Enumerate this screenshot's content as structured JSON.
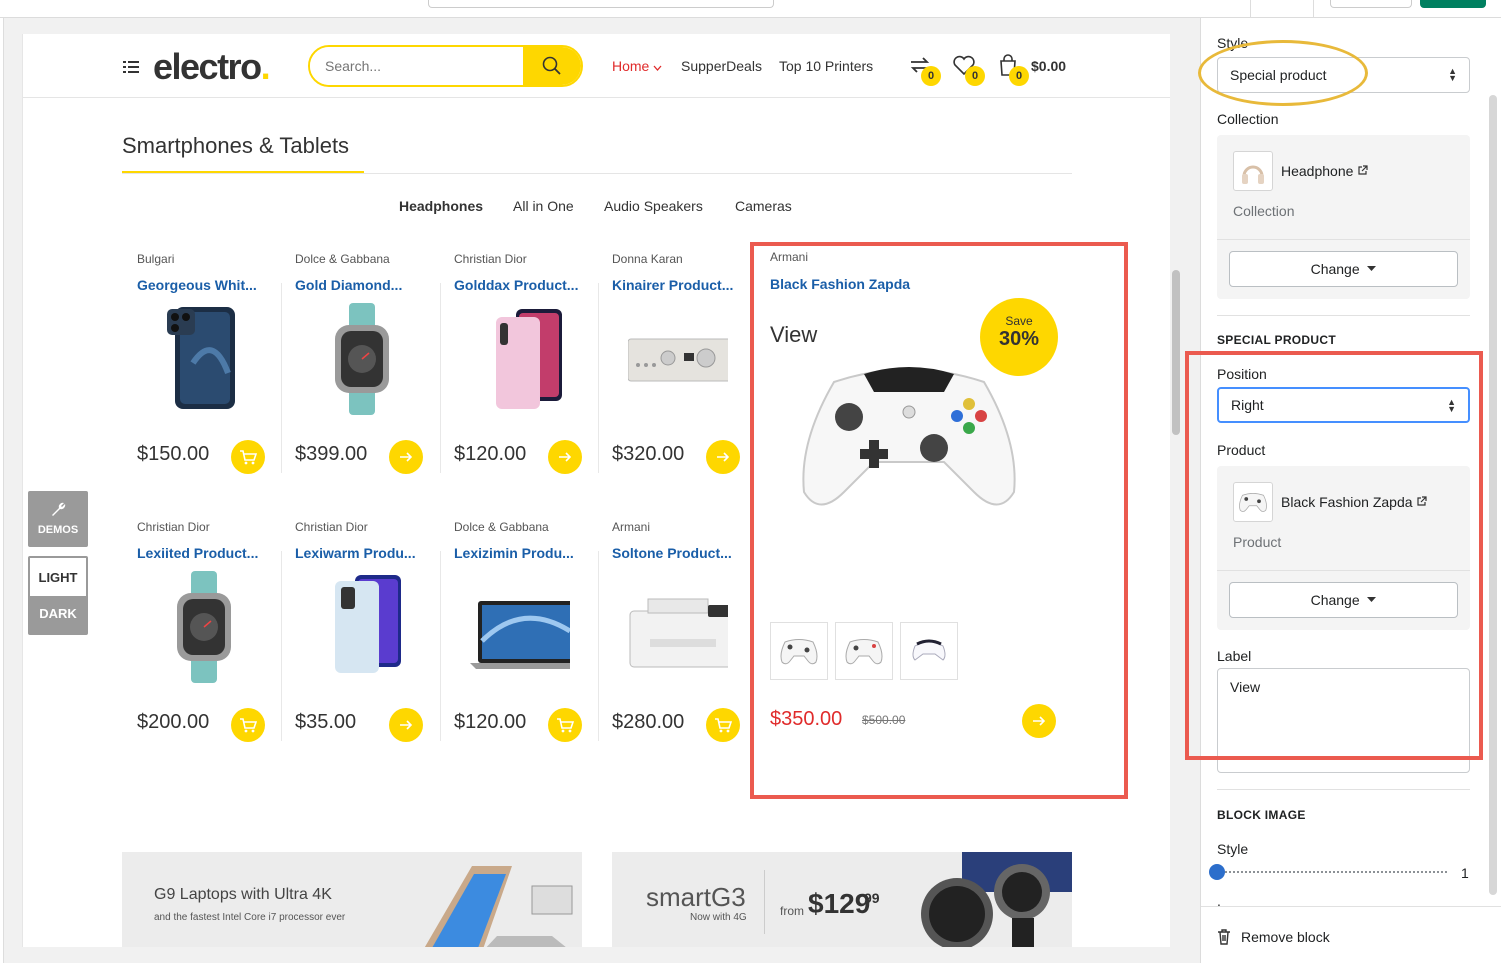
{
  "header": {
    "logo_text": "electro",
    "logo_dot": ".",
    "search_placeholder": "Search...",
    "nav": [
      "Home",
      "SupperDeals",
      "Top 10 Printers"
    ],
    "compare_count": "0",
    "wishlist_count": "0",
    "cart_count": "0",
    "cart_total": "$0.00"
  },
  "section": {
    "title": "Smartphones & Tablets",
    "tabs": [
      "Headphones",
      "All in One",
      "Audio Speakers",
      "Cameras"
    ]
  },
  "products": [
    {
      "brand": "Bulgari",
      "name": "Georgeous Whit...",
      "price": "$150.00",
      "button": "cart-icon"
    },
    {
      "brand": "Dolce & Gabbana",
      "name": "Gold Diamond...",
      "price": "$399.00",
      "button": "arrow-icon"
    },
    {
      "brand": "Christian Dior",
      "name": "Golddax Product...",
      "price": "$120.00",
      "button": "arrow-icon"
    },
    {
      "brand": "Donna Karan",
      "name": "Kinairer Product...",
      "price": "$320.00",
      "button": "arrow-icon"
    },
    {
      "brand": "Christian Dior",
      "name": "Lexiited Product...",
      "price": "$200.00",
      "button": "cart-icon"
    },
    {
      "brand": "Christian Dior",
      "name": "Lexiwarm Produ...",
      "price": "$35.00",
      "button": "arrow-icon"
    },
    {
      "brand": "Dolce & Gabbana",
      "name": "Lexizimin Produ...",
      "price": "$120.00",
      "button": "cart-icon"
    },
    {
      "brand": "Armani",
      "name": "Soltone Product...",
      "price": "$280.00",
      "button": "cart-icon"
    }
  ],
  "special": {
    "brand": "Armani",
    "name": "Black Fashion Zapda",
    "label": "View",
    "save_text": "Save",
    "save_percent": "30%",
    "price": "$350.00",
    "old_price": "$500.00"
  },
  "banners": [
    {
      "title": "G9 Laptops with Ultra 4K",
      "subtitle": "and the fastest Intel Core i7 processor ever"
    },
    {
      "title": "smartG3",
      "subtitle": "Now with 4G",
      "from": "from",
      "price": "$129",
      "cents": "99"
    }
  ],
  "side_tools": {
    "demos": "DEMOS",
    "light": "LIGHT",
    "dark": "DARK"
  },
  "panel": {
    "style_label": "Style",
    "style_value": "Special product",
    "collection_label": "Collection",
    "collection_name": "Headphone",
    "collection_type": "Collection",
    "change_label": "Change",
    "special_heading": "SPECIAL PRODUCT",
    "position_label": "Position",
    "position_value": "Right",
    "product_label": "Product",
    "product_name": "Black Fashion Zapda",
    "product_type": "Product",
    "label_label": "Label",
    "label_value": "View",
    "block_image_heading": "BLOCK IMAGE",
    "block_style_label": "Style",
    "block_style_value": "1",
    "image_label": "Image",
    "remove_label": "Remove block"
  },
  "colors": {
    "accent": "#fed700",
    "link": "#1a5ea8",
    "sale": "#e02b2b",
    "highlight": "#eb5a4f",
    "focus": "#458fff"
  }
}
